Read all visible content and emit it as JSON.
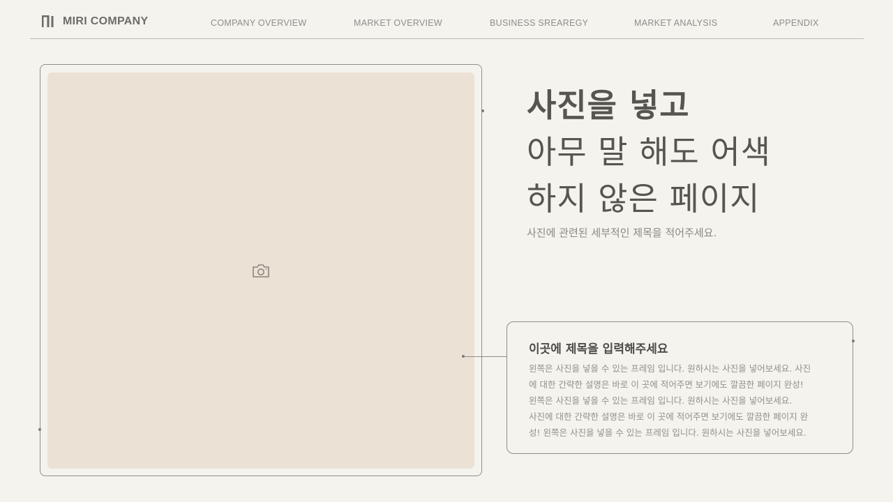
{
  "header": {
    "company_name": "MIRI COMPANY",
    "nav": [
      "COMPANY OVERVIEW",
      "MARKET OVERVIEW",
      "BUSINESS SREAREGY",
      "MARKET ANALYSIS",
      "APPENDIX"
    ]
  },
  "photo": {
    "placeholder_icon": "camera-icon",
    "fill_color": "#ebe1d4"
  },
  "headline": {
    "line1": "사진을 넣고",
    "line2": "아무 말 해도 어색",
    "line3": "하지 않은 페이지",
    "subtitle": "사진에 관련된 세부적인 제목을 적어주세요."
  },
  "info": {
    "title": "이곳에 제목을 입력해주세요",
    "lines": [
      "왼쪽은 사진을 넣을 수 있는 프레임 입니다. 원하시는 사진을 넣어보세요. 사진",
      "에 대한 간략한 설명은 바로 이 곳에 적어주면 보기에도 깔끔한 페이지 완성!",
      "왼쪽은 사진을 넣을 수 있는 프레임 입니다. 원하시는 사진을 넣어보세요.",
      "사진에 대한 간략한 설명은 바로 이 곳에 적어주면 보기에도 깔끔한 페이지 완",
      "성! 왼쪽은 사진을 넣을 수 있는 프레임 입니다. 원하시는 사진을 넣어보세요."
    ]
  },
  "colors": {
    "background": "#f4f3ee",
    "text": "#56554f",
    "accent_line": "#8f8e8a"
  }
}
